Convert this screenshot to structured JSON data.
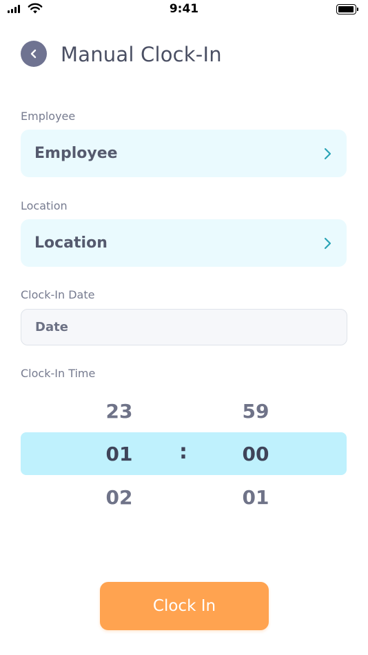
{
  "status_bar": {
    "time": "9:41"
  },
  "header": {
    "title": "Manual Clock-In"
  },
  "employee": {
    "label": "Employee",
    "value": "Employee"
  },
  "location": {
    "label": "Location",
    "value": "Location"
  },
  "date": {
    "label": "Clock-In Date",
    "placeholder": "Date"
  },
  "time": {
    "label": "Clock-In Time",
    "hours": {
      "prev": "23",
      "selected": "01",
      "next": "02"
    },
    "minutes": {
      "prev": "59",
      "selected": "00",
      "next": "01"
    },
    "separator": ":"
  },
  "action": {
    "label": "Clock In"
  },
  "colors": {
    "accent": "#ffa350",
    "field_bg": "#eafafe",
    "picker_highlight": "#bff1fd",
    "chevron": "#2aa3b5"
  }
}
